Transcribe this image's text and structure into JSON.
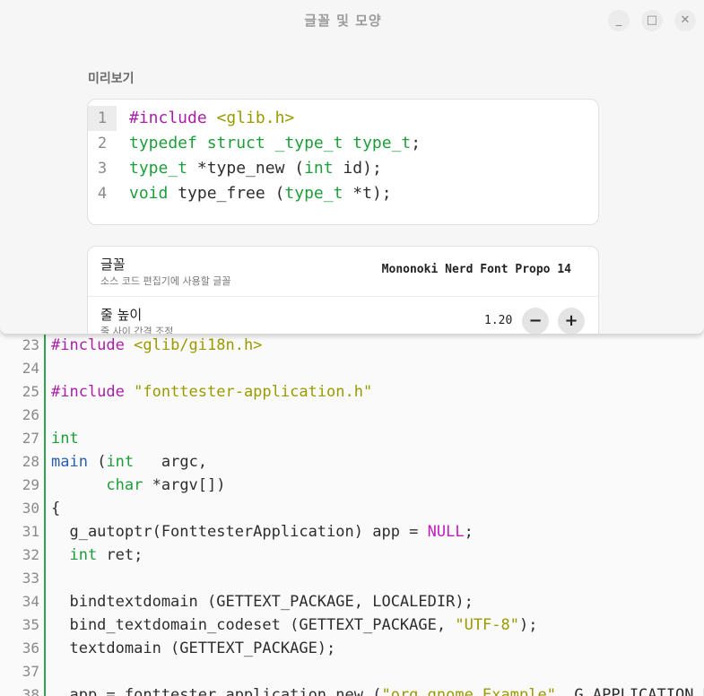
{
  "dialog": {
    "title": "글꼴 및 모양",
    "buttons": {
      "minimize": "_",
      "maximize": "□",
      "close": "✕"
    },
    "preview_label": "미리보기",
    "preview_lines": [
      {
        "num": "1",
        "segments": [
          {
            "t": "#include ",
            "c": "pre"
          },
          {
            "t": "<glib.h>",
            "c": "str"
          }
        ]
      },
      {
        "num": "2",
        "segments": [
          {
            "t": "typedef struct _type_t type_t",
            "c": "type"
          },
          {
            "t": ";",
            "c": ""
          }
        ]
      },
      {
        "num": "3",
        "segments": [
          {
            "t": "type_t",
            "c": "type"
          },
          {
            "t": " *type_new (",
            "c": ""
          },
          {
            "t": "int",
            "c": "type"
          },
          {
            "t": " id);",
            "c": ""
          }
        ]
      },
      {
        "num": "4",
        "segments": [
          {
            "t": "void",
            "c": "type"
          },
          {
            "t": " type_free (",
            "c": ""
          },
          {
            "t": "type_t",
            "c": "type"
          },
          {
            "t": " *t);",
            "c": ""
          }
        ]
      }
    ],
    "font_row": {
      "title": "글꼴",
      "subtitle": "소스 코드 편집기에 사용할 글꼴",
      "value": "Mononoki Nerd Font Propo 14"
    },
    "line_height_row": {
      "title": "줄 높이",
      "subtitle": "줄 사이 간격 조정",
      "value": "1.20",
      "minus": "−",
      "plus": "+"
    }
  },
  "editor": {
    "lines": [
      {
        "num": "23",
        "segments": [
          {
            "t": "#include ",
            "c": "pre"
          },
          {
            "t": "<glib/gi18n.h>",
            "c": "str"
          }
        ]
      },
      {
        "num": "24",
        "segments": []
      },
      {
        "num": "25",
        "segments": [
          {
            "t": "#include ",
            "c": "pre"
          },
          {
            "t": "\"fonttester-application.h\"",
            "c": "str"
          }
        ]
      },
      {
        "num": "26",
        "segments": []
      },
      {
        "num": "27",
        "segments": [
          {
            "t": "int",
            "c": "type"
          }
        ]
      },
      {
        "num": "28",
        "segments": [
          {
            "t": "main",
            "c": "blue"
          },
          {
            "t": " (",
            "c": ""
          },
          {
            "t": "int",
            "c": "type"
          },
          {
            "t": "   argc,",
            "c": ""
          }
        ]
      },
      {
        "num": "29",
        "segments": [
          {
            "t": "      ",
            "c": ""
          },
          {
            "t": "char",
            "c": "type"
          },
          {
            "t": " *argv[])",
            "c": ""
          }
        ]
      },
      {
        "num": "30",
        "segments": [
          {
            "t": "{",
            "c": ""
          }
        ]
      },
      {
        "num": "31",
        "segments": [
          {
            "t": "  g_autoptr(FonttesterApplication) app = ",
            "c": ""
          },
          {
            "t": "NULL",
            "c": "null"
          },
          {
            "t": ";",
            "c": ""
          }
        ]
      },
      {
        "num": "32",
        "segments": [
          {
            "t": "  ",
            "c": ""
          },
          {
            "t": "int",
            "c": "type"
          },
          {
            "t": " ret;",
            "c": ""
          }
        ]
      },
      {
        "num": "33",
        "segments": []
      },
      {
        "num": "34",
        "segments": [
          {
            "t": "  bindtextdomain (GETTEXT_PACKAGE, LOCALEDIR);",
            "c": ""
          }
        ]
      },
      {
        "num": "35",
        "segments": [
          {
            "t": "  bind_textdomain_codeset (GETTEXT_PACKAGE, ",
            "c": ""
          },
          {
            "t": "\"UTF-8\"",
            "c": "str"
          },
          {
            "t": ");",
            "c": ""
          }
        ]
      },
      {
        "num": "36",
        "segments": [
          {
            "t": "  textdomain (GETTEXT_PACKAGE);",
            "c": ""
          }
        ]
      },
      {
        "num": "37",
        "segments": []
      },
      {
        "num": "38",
        "segments": [
          {
            "t": "  app = fonttester_application_new (",
            "c": ""
          },
          {
            "t": "\"org.gnome.Example\"",
            "c": "str"
          },
          {
            "t": ", G_APPLICATION_DE",
            "c": ""
          }
        ]
      }
    ]
  },
  "colors": {
    "pre": "#a81fa8",
    "str": "#9a9a00",
    "type": "#1e9e3a",
    "blue": "#2a5fb0",
    "null": "#c01ec0",
    "gutter_bar": "#2ea44f"
  }
}
